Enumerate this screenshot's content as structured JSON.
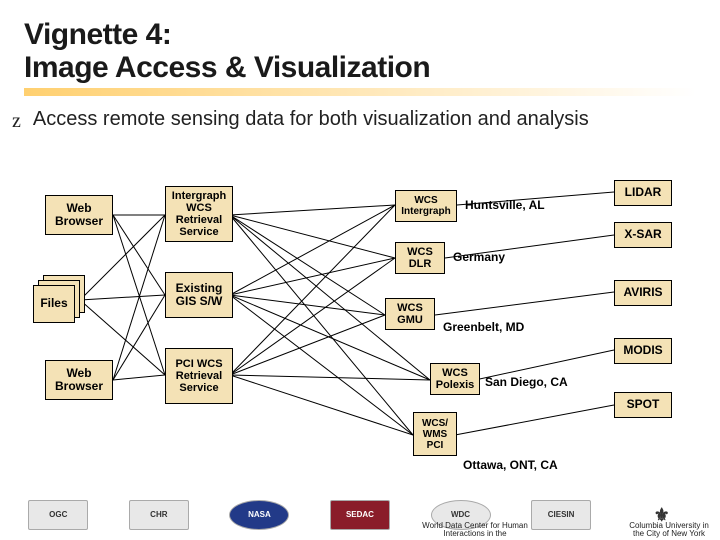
{
  "title_line1": "Vignette 4:",
  "title_line2": "Image Access & Visualization",
  "bullet": "Access remote sensing data for both visualization and analysis",
  "left": {
    "web_browser": "Web Browser",
    "files": "Files"
  },
  "mid": {
    "intergraph": "Intergraph WCS Retrieval Service",
    "gis": "Existing GIS S/W",
    "pci": "PCI WCS Retrieval Service"
  },
  "wcs": {
    "intergraph": "WCS Intergraph",
    "dlr": "WCS DLR",
    "gmu": "WCS GMU",
    "polexis": "WCS Polexis",
    "wms": "WCS/ WMS PCI"
  },
  "loc": {
    "huntsville": "Huntsville, AL",
    "germany": "Germany",
    "greenbelt": "Greenbelt, MD",
    "sandiego": "San Diego, CA",
    "ottawa": "Ottawa, ONT, CA"
  },
  "sensors": {
    "lidar": "LIDAR",
    "xsar": "X-SAR",
    "aviris": "AVIRIS",
    "modis": "MODIS",
    "spot": "SPOT"
  },
  "footer": {
    "ogc": "OGC",
    "chr": "CHR",
    "nasa": "NASA",
    "sedac": "SEDAC",
    "wdc": "WDC",
    "ciesin": "CIESIN",
    "cu": "⚜",
    "note1": "World Data Center for Human Interactions in the",
    "note2": "Columbia University in the City of New York"
  }
}
